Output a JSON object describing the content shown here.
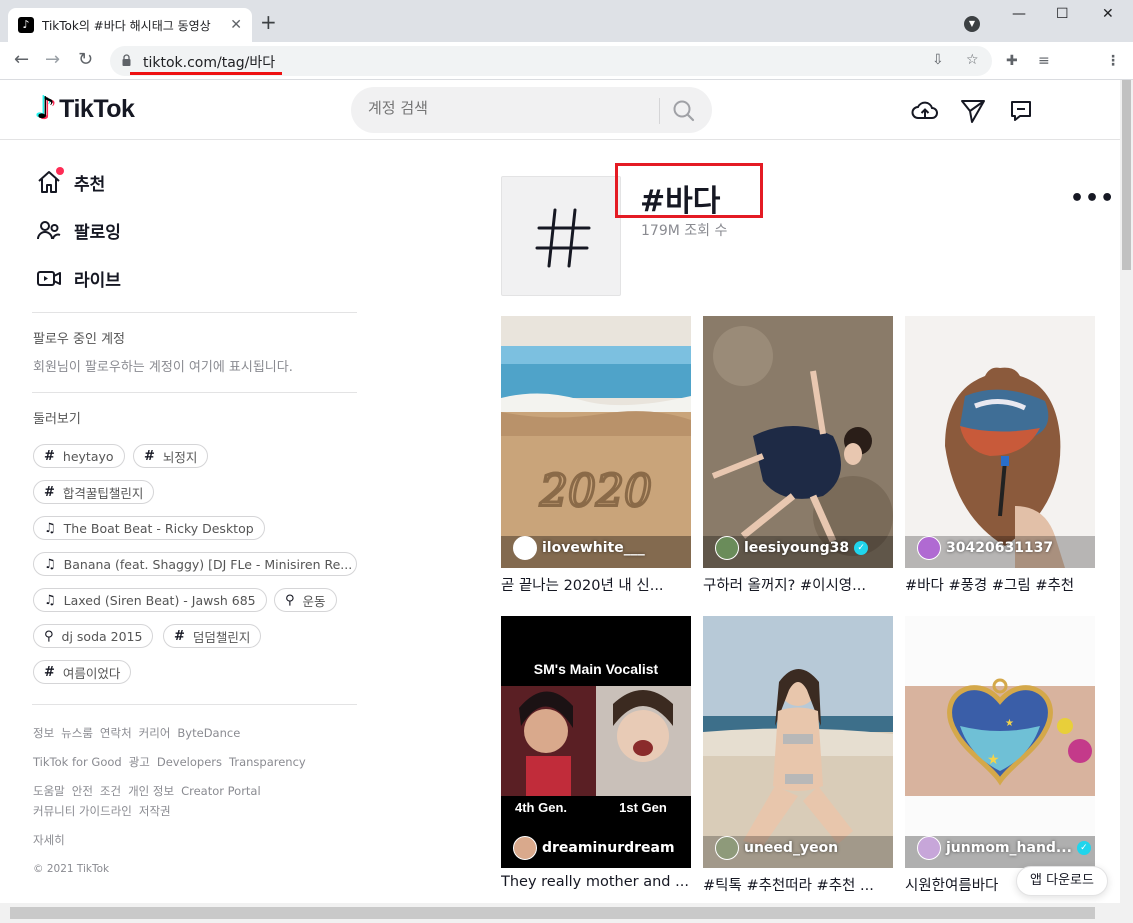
{
  "browser": {
    "tab_title": "TikTok의 #바다 해시태그 동영상",
    "tab_close": "✕",
    "new_tab": "+",
    "minimize": "—",
    "maximize": "☐",
    "close": "✕",
    "back": "←",
    "forward": "→",
    "reload": "↻",
    "url": "tiktok.com/tag/바다",
    "menu": "⋮"
  },
  "header": {
    "logo_text": "TikTok",
    "search_placeholder": "계정 검색"
  },
  "sidebar": {
    "nav": [
      {
        "label": "추천"
      },
      {
        "label": "팔로잉"
      },
      {
        "label": "라이브"
      }
    ],
    "following_title": "팔로우 중인 계정",
    "following_desc": "회원님이 팔로우하는 계정이 여기에 표시됩니다.",
    "discover_title": "둘러보기",
    "chips": [
      {
        "icon": "#",
        "label": "heytayo"
      },
      {
        "icon": "#",
        "label": "뇌정지"
      },
      {
        "icon": "#",
        "label": "합격꿀팁챌린지"
      },
      {
        "icon": "♫",
        "label": "The Boat Beat - Ricky Desktop"
      },
      {
        "icon": "♫",
        "label": "Banana (feat. Shaggy) [DJ FLe - Minisiren Re..."
      },
      {
        "icon": "♫",
        "label": "Laxed (Siren Beat) - Jawsh 685"
      },
      {
        "icon": "⚲",
        "label": "운동"
      },
      {
        "icon": "⚲",
        "label": "dj soda 2015"
      },
      {
        "icon": "#",
        "label": "덤덤챌린지"
      },
      {
        "icon": "#",
        "label": "여름이었다"
      }
    ],
    "footer": {
      "row1": [
        "정보",
        "뉴스룸",
        "연락처",
        "커리어",
        "ByteDance"
      ],
      "row2": [
        "TikTok for Good",
        "광고",
        "Developers",
        "Transparency"
      ],
      "row3": [
        "도움말",
        "안전",
        "조건",
        "개인 정보",
        "Creator Portal"
      ],
      "row4": [
        "커뮤니티 가이드라인",
        "저작권"
      ],
      "more": "자세히",
      "copyright": "© 2021 TikTok"
    }
  },
  "tag": {
    "symbol": "#",
    "title": "#바다",
    "views": "179M 조회 수",
    "more": "•••"
  },
  "videos": [
    {
      "user": "ilovewhite___",
      "caption": "곧 끝나는 2020년 내 신...",
      "verified": false
    },
    {
      "user": "leesiyoung38",
      "caption": "구하러 올꺼지? #이시영...",
      "verified": true
    },
    {
      "user": "30420631137",
      "caption": "#바다 #풍경 #그림 #추천",
      "verified": false
    },
    {
      "user": "dreaminurdream",
      "caption": "They really mother and ...",
      "verified": false,
      "overlay_title": "SM's Main Vocalist",
      "overlay_left": "4th Gen.",
      "overlay_right": "1st Gen"
    },
    {
      "user": "uneed_yeon",
      "caption": "#틱톡 #추천떠라 #추천 ...",
      "verified": false
    },
    {
      "user": "junmom_hand...",
      "caption": "시원한여름바다",
      "verified": true
    }
  ],
  "thumb_sand_text": "2020",
  "verified_mark": "✓",
  "download_label": "앱 다운로드",
  "colors": {
    "accent": "#fe2c55",
    "highlight_box": "#e41b24",
    "verified": "#20d5ec"
  }
}
